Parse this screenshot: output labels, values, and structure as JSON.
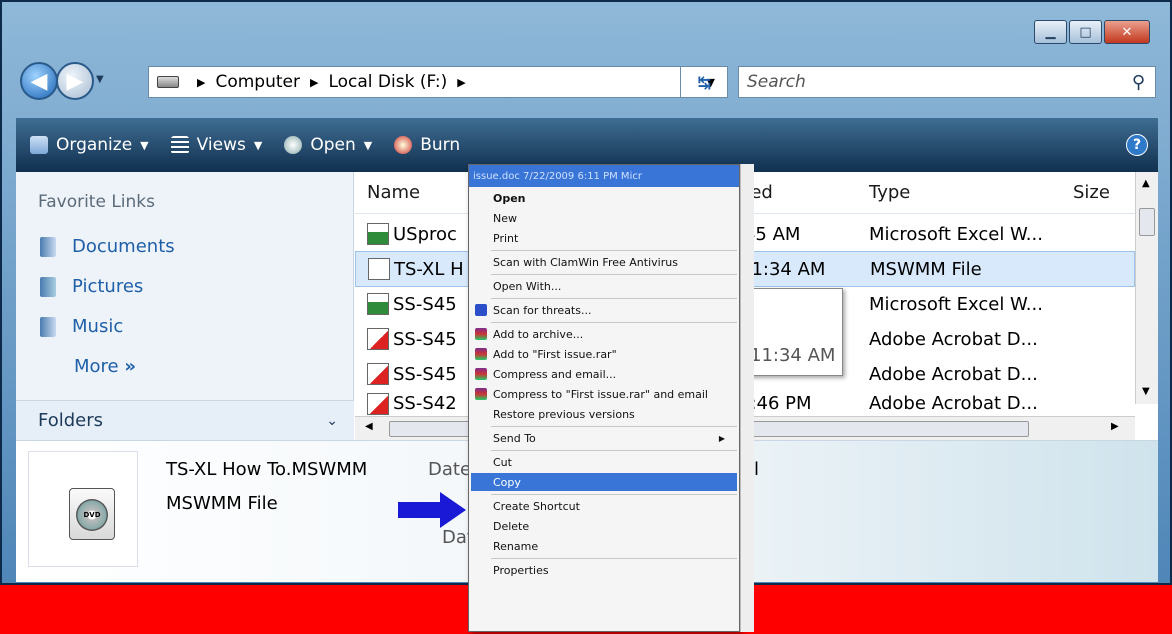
{
  "window": {
    "minimize": "▭",
    "maximize": "▭",
    "close": "✕"
  },
  "nav": {
    "breadcrumb": [
      "Computer",
      "Local Disk (F:)"
    ],
    "search_placeholder": "Search"
  },
  "toolbar": {
    "organize": "Organize",
    "views": "Views",
    "open": "Open",
    "burn": "Burn",
    "help": "?"
  },
  "sidebar": {
    "title": "Favorite Links",
    "links": [
      "Documents",
      "Pictures",
      "Music"
    ],
    "more": "More",
    "folders": "Folders"
  },
  "list": {
    "headers": {
      "name": "Name",
      "modified": "fied",
      "type": "Type",
      "size": "Size"
    },
    "rows": [
      {
        "name": "USproc",
        "date": "'45 AM",
        "type": "Microsoft Excel W...",
        "icon": "excel-icon"
      },
      {
        "name": "TS-XL H",
        "date": "11:34 AM",
        "type": "MSWMM File",
        "icon": "mswmm-icon"
      },
      {
        "name": "SS-S45",
        "date": "",
        "type": "Microsoft Excel W...",
        "icon": "excel-icon"
      },
      {
        "name": "SS-S45",
        "date": "",
        "type": "Adobe Acrobat D...",
        "icon": "pdf-icon"
      },
      {
        "name": "SS-S45",
        "date": "",
        "type": "Adobe Acrobat D...",
        "icon": "pdf-icon"
      },
      {
        "name": "SS-S42",
        "date": "1:46 PM",
        "type": "Adobe Acrobat D...",
        "icon": "pdf-icon"
      }
    ],
    "tooltip": "11:34 AM"
  },
  "details": {
    "name": "TS-XL How To.MSWMM",
    "date_label": "Date",
    "type": "MSWMM File",
    "date_label2": "Dat",
    "icon_text": "DVD"
  },
  "context_menu": {
    "ghost_row": "issue.doc          7/22/2009 6:11 PM       Micr",
    "items": [
      {
        "label": "Open",
        "bold": true
      },
      {
        "label": "New"
      },
      {
        "label": "Print"
      },
      {
        "sep": true
      },
      {
        "label": "Scan with ClamWin Free Antivirus"
      },
      {
        "sep": true
      },
      {
        "label": "Open With..."
      },
      {
        "sep": true
      },
      {
        "label": "Scan for threats...",
        "icon": "shield-icon"
      },
      {
        "sep": true
      },
      {
        "label": "Add to archive...",
        "icon": "winrar-icon"
      },
      {
        "label": "Add to \"First issue.rar\"",
        "icon": "winrar-icon"
      },
      {
        "label": "Compress and email...",
        "icon": "winrar-icon"
      },
      {
        "label": "Compress to \"First issue.rar\" and email",
        "icon": "winrar-icon"
      },
      {
        "label": "Restore previous versions"
      },
      {
        "sep": true
      },
      {
        "label": "Send To",
        "submenu": true
      },
      {
        "sep": true
      },
      {
        "label": "Cut"
      },
      {
        "label": "Copy",
        "selected": true
      },
      {
        "sep": true
      },
      {
        "label": "Create Shortcut"
      },
      {
        "label": "Delete"
      },
      {
        "label": "Rename"
      },
      {
        "sep": true
      },
      {
        "label": "Properties"
      }
    ]
  },
  "colors": {
    "frame_red": "#ff0000",
    "selection": "#3875d7",
    "arrow": "#1a1ad6"
  }
}
